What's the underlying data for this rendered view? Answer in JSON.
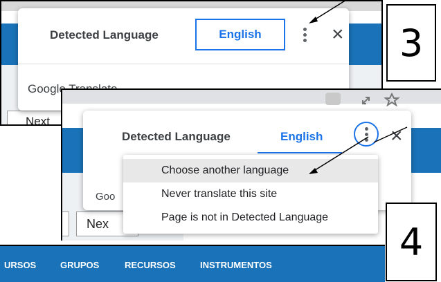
{
  "step_labels": {
    "top": "3",
    "bottom": "4"
  },
  "panel_top": {
    "dialog": {
      "detected_tab": "Detected Language",
      "english_tab": "English",
      "more_icon": "vertical-dots-icon",
      "close_icon": "×",
      "footer": "Google Translate"
    },
    "next_button": "Next"
  },
  "panel_bottom": {
    "dialog": {
      "detected_tab": "Detected Language",
      "english_tab": "English",
      "more_icon": "vertical-dots-icon",
      "close_icon": "×",
      "footer_partial": "Goo"
    },
    "next_button": "Nex",
    "menu": {
      "items": [
        {
          "label": "Choose another language",
          "highlighted": true
        },
        {
          "label": "Never translate this site",
          "highlighted": false
        },
        {
          "label": "Page is not in Detected Language",
          "highlighted": false
        }
      ]
    }
  },
  "nav_bar": {
    "items": [
      "URSOS",
      "GRUPOS",
      "RECURSOS",
      "INSTRUMENTOS"
    ]
  },
  "colors": {
    "accent": "#1a73e8",
    "nav_blue": "#1a73b8",
    "text": "#3c4043"
  }
}
